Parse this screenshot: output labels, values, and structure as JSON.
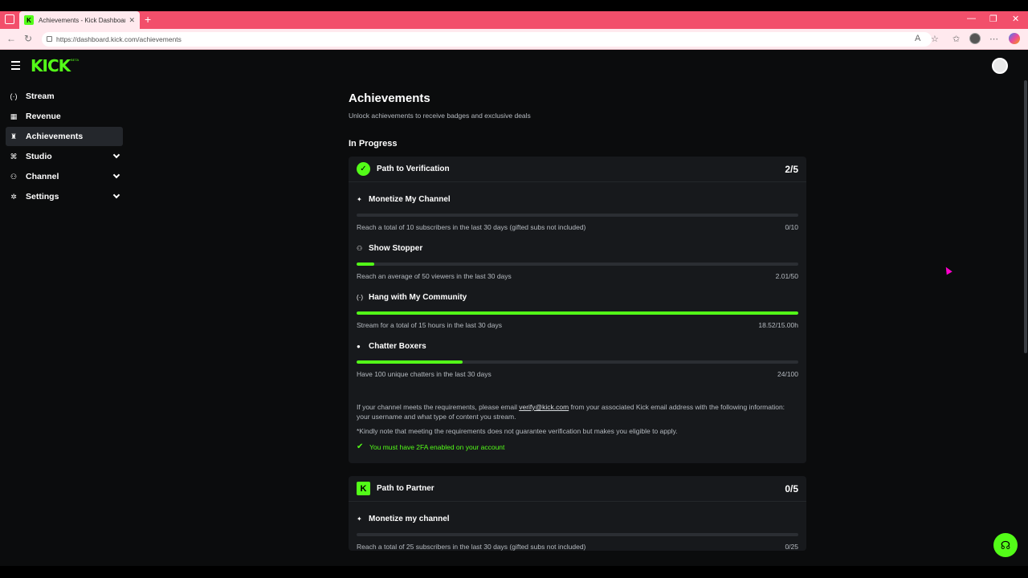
{
  "browser": {
    "tab_title": "Achievements - Kick Dashboard",
    "url": "https://dashboard.kick.com/achievements"
  },
  "app": {
    "logo": "KICK",
    "logo_badge": "BETA"
  },
  "sidebar": {
    "items": [
      {
        "label": "Stream",
        "icon": "broadcast-icon",
        "glyph": "(·)",
        "active": false,
        "expandable": false
      },
      {
        "label": "Revenue",
        "icon": "revenue-icon",
        "glyph": "▦",
        "active": false,
        "expandable": false
      },
      {
        "label": "Achievements",
        "icon": "trophy-icon",
        "glyph": "♜",
        "active": true,
        "expandable": false
      },
      {
        "label": "Studio",
        "icon": "studio-icon",
        "glyph": "⌘",
        "active": false,
        "expandable": true
      },
      {
        "label": "Channel",
        "icon": "channel-icon",
        "glyph": "⚇",
        "active": false,
        "expandable": true
      },
      {
        "label": "Settings",
        "icon": "gear-icon",
        "glyph": "✲",
        "active": false,
        "expandable": true
      }
    ]
  },
  "main": {
    "title": "Achievements",
    "subtitle": "Unlock achievements to receive badges and exclusive deals",
    "section_in_progress": "In Progress",
    "verification": {
      "title": "Path to Verification",
      "count": "2/5",
      "tasks": [
        {
          "name": "Monetize My Channel",
          "desc": "Reach a total of 10 subscribers in the last 30 days (gifted subs not included)",
          "progress": "0/10",
          "fraction": 0
        },
        {
          "name": "Show Stopper",
          "desc": "Reach an average of 50 viewers in the last 30 days",
          "progress": "2.01/50",
          "fraction": 0.04
        },
        {
          "name": "Hang with My Community",
          "desc": "Stream for a total of 15 hours in the last 30 days",
          "progress": "18.52/15.00h",
          "fraction": 1
        },
        {
          "name": "Chatter Boxers",
          "desc": "Have 100 unique chatters in the last 30 days",
          "progress": "24/100",
          "fraction": 0.24
        }
      ],
      "info_prefix": "If your channel meets the requirements, please email ",
      "info_email": "verify@kick.com",
      "info_suffix": " from your associated Kick email address with the following information: your username and what type of content you stream.",
      "note": "*Kindly note that meeting the requirements does not guarantee verification but makes you eligible to apply.",
      "requirement": "You must have 2FA enabled on your account"
    },
    "partner": {
      "title": "Path to Partner",
      "count": "0/5",
      "tasks": [
        {
          "name": "Monetize my channel",
          "desc": "Reach a total of 25 subscribers in the last 30 days (gifted subs not included)",
          "progress": "0/25",
          "fraction": 0
        }
      ]
    }
  },
  "colors": {
    "accent": "#53fc18",
    "background": "#0b0c0d",
    "card": "#17191c",
    "browser_tab_bar": "#f24f6b"
  }
}
